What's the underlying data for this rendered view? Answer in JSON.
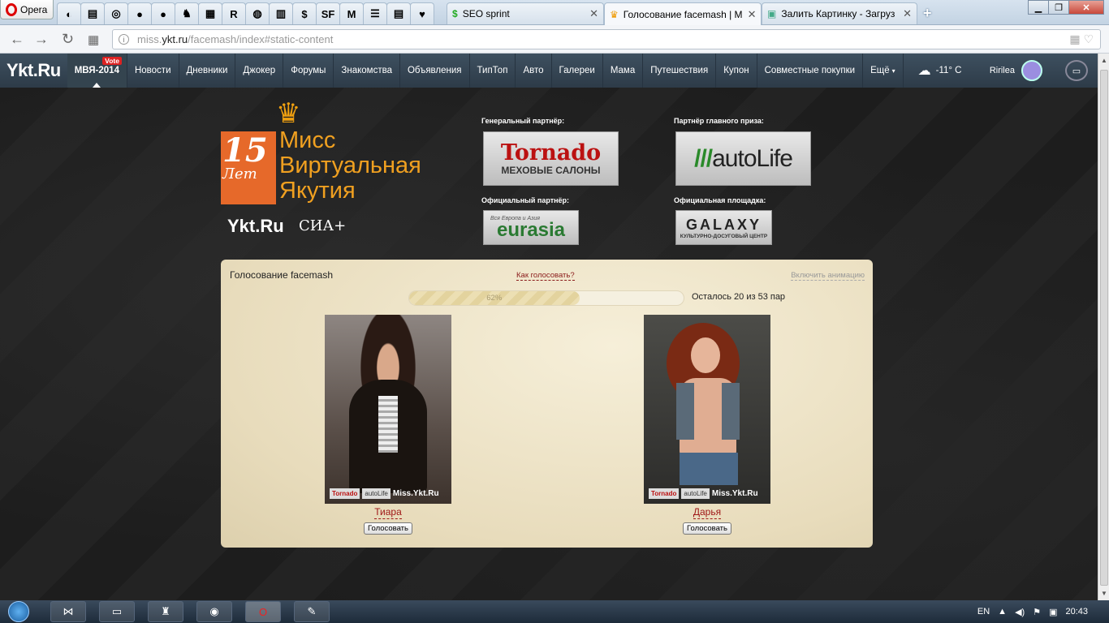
{
  "browser": {
    "app_name": "Opera",
    "tabs": [
      {
        "label": "SEO sprint",
        "active": false
      },
      {
        "label": "Голосование facemash | M",
        "active": true
      },
      {
        "label": "Залить Картинку - Загруз",
        "active": false
      }
    ],
    "pinned_icons": [
      "ie-icon",
      "doc-icon",
      "apple-icon",
      "peach-icon",
      "peach-icon",
      "owl-icon",
      "qr-icon",
      "r-icon",
      "globe-icon",
      "chart-icon",
      "dollar-icon",
      "sf-icon",
      "m-icon",
      "list-icon",
      "doc-icon",
      "heart-icon"
    ],
    "pinned_glyphs": [
      "◐",
      "▤",
      "◎",
      "●",
      "●",
      "♞",
      "▦",
      "R",
      "◍",
      "▥",
      "$",
      "SF",
      "M",
      "☰",
      "▤",
      "♥"
    ],
    "url_domain_prefix": "miss.",
    "url_domain": "ykt.ru",
    "url_path": "/facemash/index#static-content",
    "new_tab": "+"
  },
  "site_nav": {
    "logo": "Ykt.Ru",
    "items": [
      "МВЯ-2014",
      "Новости",
      "Дневники",
      "Джокер",
      "Форумы",
      "Знакомства",
      "Объявления",
      "ТипТоп",
      "Авто",
      "Галереи",
      "Мама",
      "Путешествия",
      "Купон",
      "Совместные покупки",
      "Ещё"
    ],
    "vote_badge": "Vote",
    "weather": "-11° C",
    "username": "Ririlea"
  },
  "header": {
    "logo_number": "15",
    "logo_years": "Лет",
    "logo_title_line1": "Мисс",
    "logo_title_line2": "Виртуальная",
    "logo_title_line3": "Якутия",
    "logo_site": "Ykt.Ru",
    "logo_partner": "СИА+",
    "partners": {
      "general_label": "Генеральный партнёр:",
      "general_name": "Tornado",
      "general_sub": "МЕХОВЫЕ САЛОНЫ",
      "prize_label": "Партнёр главного приза:",
      "prize_name_a": "auto",
      "prize_name_b": "Life",
      "official_label": "Официальный партнёр:",
      "official_name": "eurasia",
      "official_tagline": "Вся Европа и Азия",
      "venue_label": "Официальная площадка:",
      "venue_name": "GALAXY",
      "venue_sub": "КУЛЬТУРНО-ДОСУГОВЫЙ ЦЕНТР"
    }
  },
  "voting": {
    "title": "Голосование facemash",
    "how_to": "Как голосовать?",
    "animation_toggle": "Включить анимацию",
    "progress_label": "62%",
    "progress_fraction": 0.62,
    "remaining": "Осталось 20 из 53 пар",
    "candidates": [
      {
        "name": "Тиара",
        "vote_label": "Голосовать"
      },
      {
        "name": "Дарья",
        "vote_label": "Голосовать"
      }
    ],
    "watermark_tornado": "Tornado",
    "watermark_autolife": "autoLife",
    "watermark_site": "Miss.Ykt.Ru"
  },
  "taskbar": {
    "lang": "EN",
    "time": "20:43"
  }
}
